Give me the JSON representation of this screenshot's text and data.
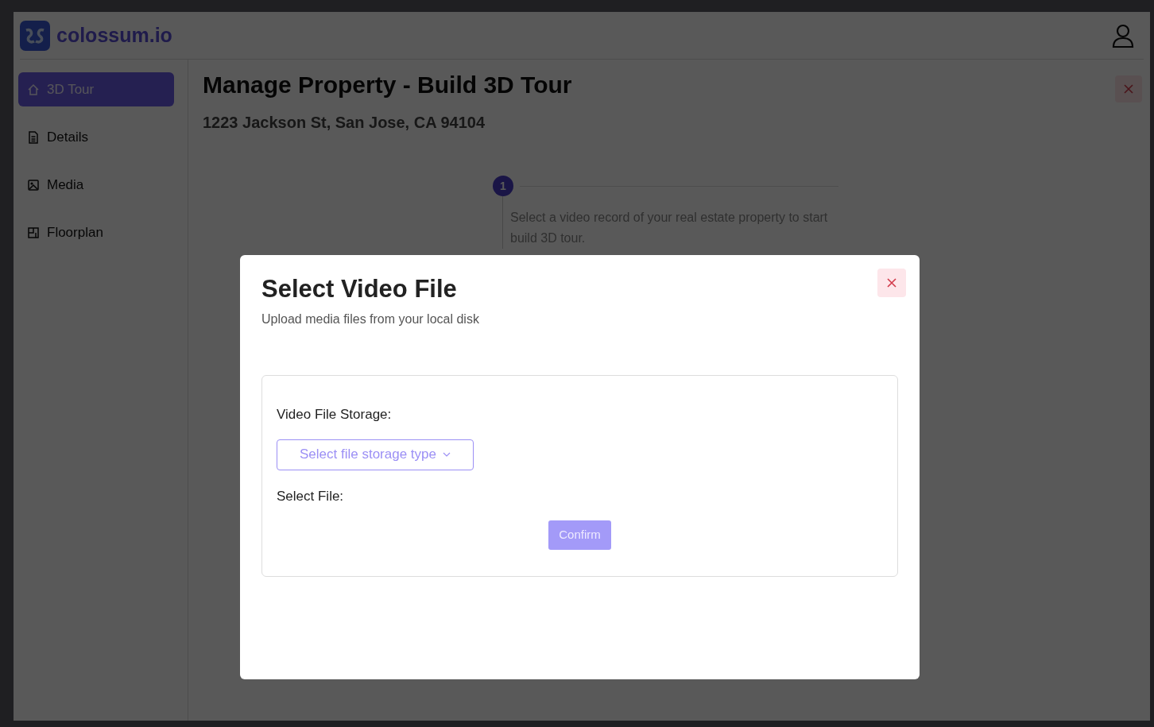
{
  "header": {
    "logo_text": "colossum.io"
  },
  "sidebar": {
    "items": [
      {
        "label": "3D Tour",
        "selected": true
      },
      {
        "label": "Details",
        "selected": false
      },
      {
        "label": "Media",
        "selected": false
      },
      {
        "label": "Floorplan",
        "selected": false
      }
    ]
  },
  "page": {
    "title": "Manage Property - Build 3D Tour",
    "address": "1223 Jackson St, San Jose, CA 94104",
    "steps": [
      {
        "number": "1",
        "description": "Select a video record of your real estate property to start build 3D tour."
      }
    ]
  },
  "modal": {
    "title": "Select Video File",
    "subtitle": "Upload media files from your local disk",
    "storage_label": "Video File Storage:",
    "storage_select": {
      "placeholder": "Select file storage type"
    },
    "file_label": "Select File:",
    "confirm_button": {
      "label": "Confirm",
      "disabled": true
    }
  }
}
